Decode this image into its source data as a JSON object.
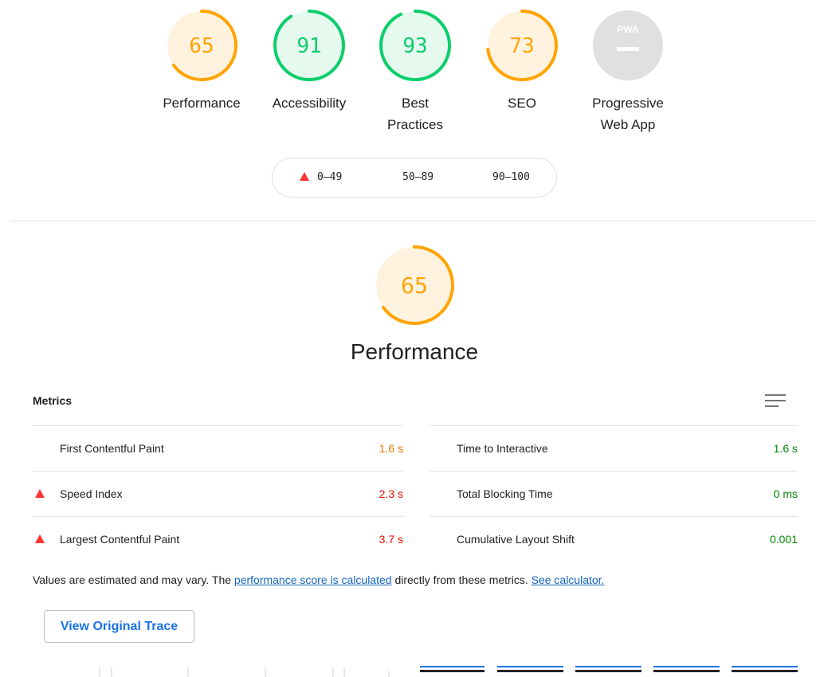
{
  "summary": {
    "gauges": [
      {
        "key": "performance",
        "score": 65,
        "label_lines": [
          "Performance"
        ],
        "color": "#ffa400",
        "fill": "#fff3e0"
      },
      {
        "key": "accessibility",
        "score": 91,
        "label_lines": [
          "Accessibility"
        ],
        "color": "#0cce6b",
        "fill": "#e6f9ef"
      },
      {
        "key": "best-practices",
        "score": 93,
        "label_lines": [
          "Best",
          "Practices"
        ],
        "color": "#0cce6b",
        "fill": "#e6f9ef"
      },
      {
        "key": "seo",
        "score": 73,
        "label_lines": [
          "SEO"
        ],
        "color": "#ffa400",
        "fill": "#fff3e0"
      }
    ],
    "pwa": {
      "badge_text": "PWA",
      "label_lines": [
        "Progressive",
        "Web App"
      ],
      "fill": "#e0e0e0"
    }
  },
  "legend": {
    "fail": "0–49",
    "average": "50–89",
    "pass": "90–100",
    "colors": {
      "fail": "#ff3333",
      "average": "#ffa400",
      "pass": "#0cce6b"
    }
  },
  "performance_detail": {
    "score": 65,
    "title": "Performance",
    "color": "#ffa400",
    "fill": "#fff3e0"
  },
  "metrics": {
    "heading": "Metrics",
    "menu_icon": "list-toggle-icon",
    "left": [
      {
        "title": "First Contentful Paint",
        "value": "1.6 s",
        "rating": "average"
      },
      {
        "title": "Speed Index",
        "value": "2.3 s",
        "rating": "fail"
      },
      {
        "title": "Largest Contentful Paint",
        "value": "3.7 s",
        "rating": "fail"
      }
    ],
    "right": [
      {
        "title": "Time to Interactive",
        "value": "1.6 s",
        "rating": "pass"
      },
      {
        "title": "Total Blocking Time",
        "value": "0 ms",
        "rating": "pass"
      },
      {
        "title": "Cumulative Layout Shift",
        "value": "0.001",
        "rating": "pass"
      }
    ],
    "rating_colors": {
      "fail": "#eb0f00",
      "average": "#e67700",
      "pass": "#008800"
    }
  },
  "note": {
    "prefix": "Values are estimated and may vary. The ",
    "link1": "performance score is calculated",
    "middle": " directly from these metrics. ",
    "link2": "See calculator."
  },
  "trace_button": "View Original Trace"
}
